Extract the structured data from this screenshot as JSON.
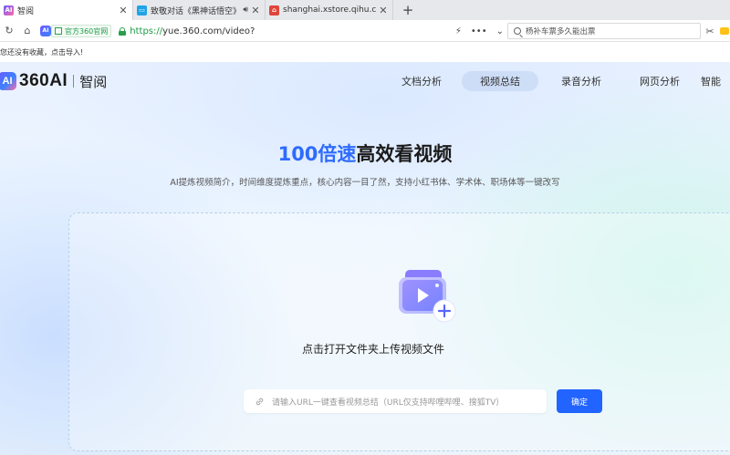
{
  "browser": {
    "tabs": [
      {
        "title": "智阅",
        "active": true,
        "favicon": "360ai-favicon"
      },
      {
        "title": "致敬对话《黑神话悟空》制",
        "active": false,
        "favicon": "bilibili-favicon",
        "audio": true
      },
      {
        "title": "shanghai.xstore.qihu.com/w",
        "active": false,
        "favicon": "pdf-favicon"
      }
    ],
    "new_tab": "+",
    "address": {
      "site_badge": "官方360官网",
      "url_scheme": "https://",
      "url_rest": "yue.360.com/video?"
    },
    "search_placeholder": "杨补车票多久能出票",
    "favorites_hint": "您还没有收藏，点击导入!"
  },
  "site": {
    "logo_badge": "AI",
    "brand": "360AI",
    "product": "智阅",
    "nav": [
      {
        "label": "文档分析",
        "active": false
      },
      {
        "label": "视频总结",
        "active": true
      },
      {
        "label": "录音分析",
        "active": false
      },
      {
        "label": "网页分析",
        "active": false
      },
      {
        "label": "智能",
        "active": false
      }
    ]
  },
  "hero": {
    "title_accent": "100倍速",
    "title_rest": "高效看视频",
    "subtitle": "AI提炼视频简介，时间维度提炼重点，核心内容一目了然，支持小红书体、学术体、职场体等一键改写"
  },
  "upload": {
    "label": "点击打开文件夹上传视频文件",
    "url_placeholder": "请输入URL一键查看视频总结（URL仅支持哔哩哔哩、搜狐TV）",
    "confirm": "确定"
  },
  "colors": {
    "accent": "#2e6bff",
    "button": "#2264ff",
    "secure_green": "#1b9c46"
  }
}
